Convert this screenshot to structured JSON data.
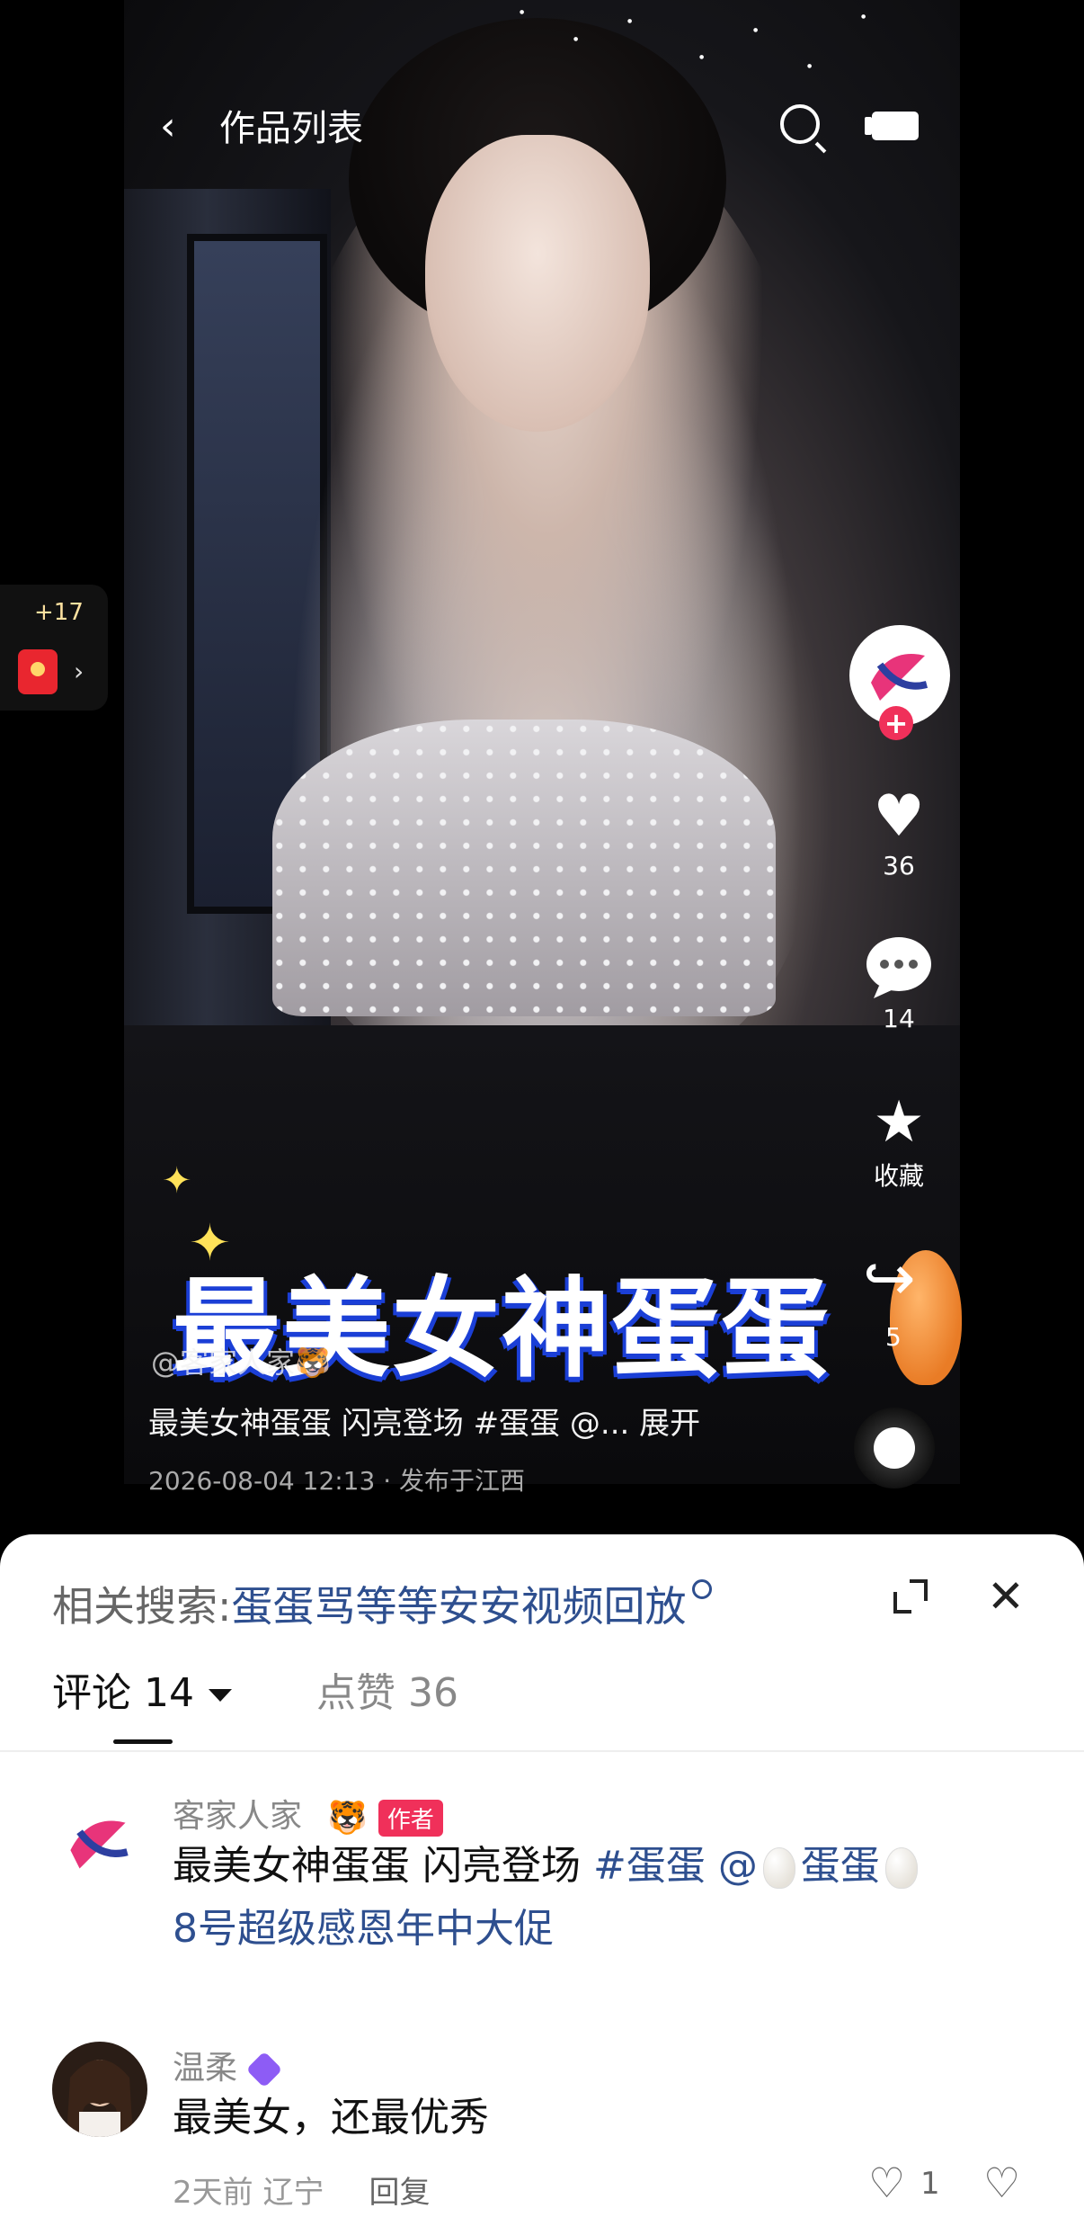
{
  "header": {
    "back_icon": "chevron-left-icon",
    "title": "作品列表",
    "search_icon": "search-icon",
    "screen_icon": "screen-cast-icon"
  },
  "left_badge": {
    "count": "+17",
    "chevron": "›"
  },
  "side": {
    "follow_plus": "+",
    "like_count": "36",
    "comment_count": "14",
    "favorite_label": "收藏",
    "share_count": "5"
  },
  "video": {
    "big_caption": "最美女神蛋蛋",
    "author": "@客家人家🐯",
    "description": "最美女神蛋蛋 闪亮登场 #蛋蛋 @... 展开",
    "meta": "2026-08-04 12:13 · 发布于江西"
  },
  "sheet": {
    "related_prefix": "相关搜索:",
    "related_keyword": "蛋蛋骂等等安安视频回放",
    "tab_comments": "评论 14",
    "tab_likes": "点赞 36",
    "close": "✕"
  },
  "comments": [
    {
      "name": "客家人家",
      "emoji": "🐯",
      "tag": "作者",
      "text_plain": "最美女神蛋蛋 闪亮登场 ",
      "text_hashtag": "#蛋蛋",
      "text_mention_prefix": " @",
      "text_mention": "蛋蛋",
      "text_line2": "8号超级感恩年中大促"
    },
    {
      "name": "温柔",
      "text": "最美女，还最优秀",
      "time": "2天前 辽宁",
      "reply": "回复",
      "likes": "1"
    }
  ],
  "colors": {
    "accent": "#f0305a",
    "link": "#2e4f8f",
    "badge": "#8d5cf5"
  }
}
